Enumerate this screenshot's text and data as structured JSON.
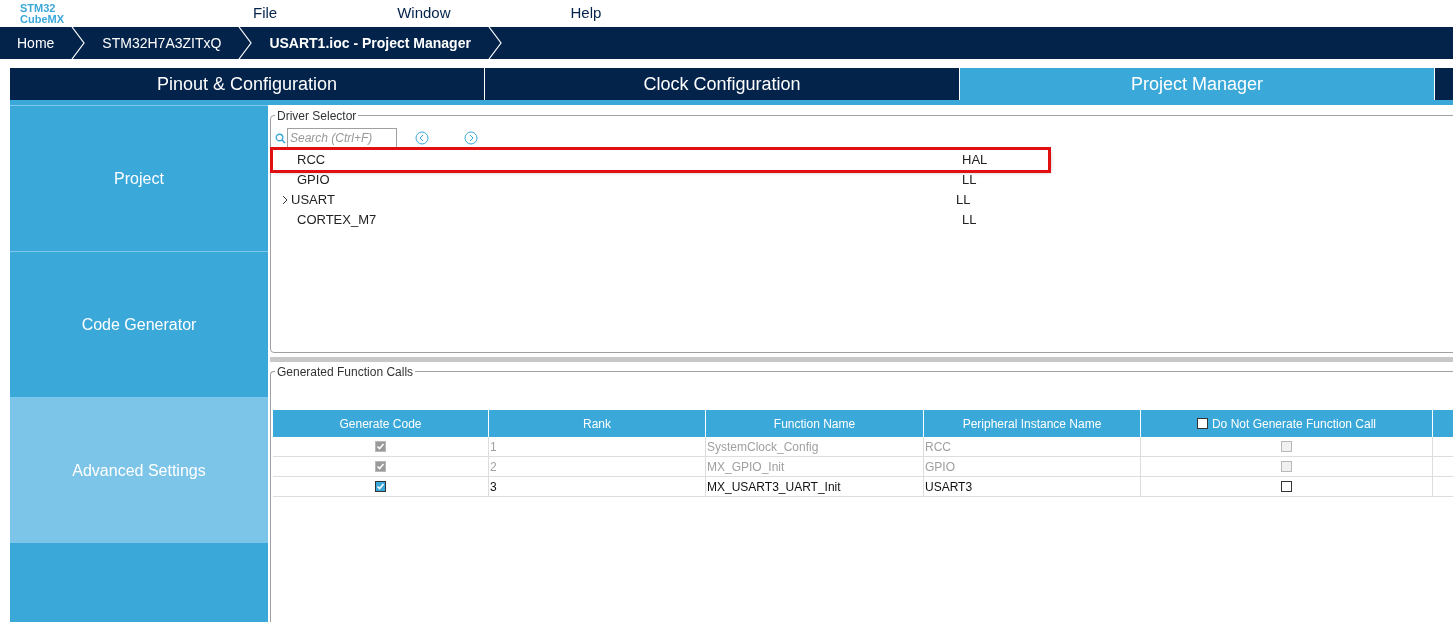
{
  "header": {
    "logo": [
      "STM32",
      "CubeMX"
    ],
    "menu": [
      "File",
      "Window",
      "Help"
    ]
  },
  "breadcrumb": [
    {
      "label": "Home",
      "selected": false
    },
    {
      "label": "STM32H7A3ZITxQ",
      "selected": false
    },
    {
      "label": "USART1.ioc - Project Manager",
      "selected": true
    }
  ],
  "tabs": [
    {
      "label": "Pinout & Configuration",
      "selected": false
    },
    {
      "label": "Clock Configuration",
      "selected": false
    },
    {
      "label": "Project Manager",
      "selected": true
    }
  ],
  "sidebar": [
    {
      "label": "Project",
      "selected": false
    },
    {
      "label": "Code Generator",
      "selected": false
    },
    {
      "label": "Advanced Settings",
      "selected": true
    }
  ],
  "driver_selector": {
    "title": "Driver Selector",
    "search": {
      "placeholder": "Search (Ctrl+F)"
    },
    "rows": [
      {
        "name": "RCC",
        "driver": "HAL",
        "expandable": false,
        "highlighted": true
      },
      {
        "name": "GPIO",
        "driver": "LL",
        "expandable": false,
        "highlighted": false
      },
      {
        "name": "USART",
        "driver": "LL",
        "expandable": true,
        "highlighted": false
      },
      {
        "name": "CORTEX_M7",
        "driver": "LL",
        "expandable": false,
        "highlighted": false
      }
    ]
  },
  "function_calls": {
    "title": "Generated Function Calls",
    "columns": [
      "Generate Code",
      "Rank",
      "Function Name",
      "Peripheral Instance Name",
      "Do Not Generate Function Call"
    ],
    "header_checked": false,
    "rows": [
      {
        "generate": true,
        "rank": "1",
        "function": "SystemClock_Config",
        "instance": "RCC",
        "do_not_generate": false,
        "disabled": true
      },
      {
        "generate": true,
        "rank": "2",
        "function": "MX_GPIO_Init",
        "instance": "GPIO",
        "do_not_generate": false,
        "disabled": true
      },
      {
        "generate": true,
        "rank": "3",
        "function": "MX_USART3_UART_Init",
        "instance": "USART3",
        "do_not_generate": false,
        "disabled": false
      }
    ]
  }
}
